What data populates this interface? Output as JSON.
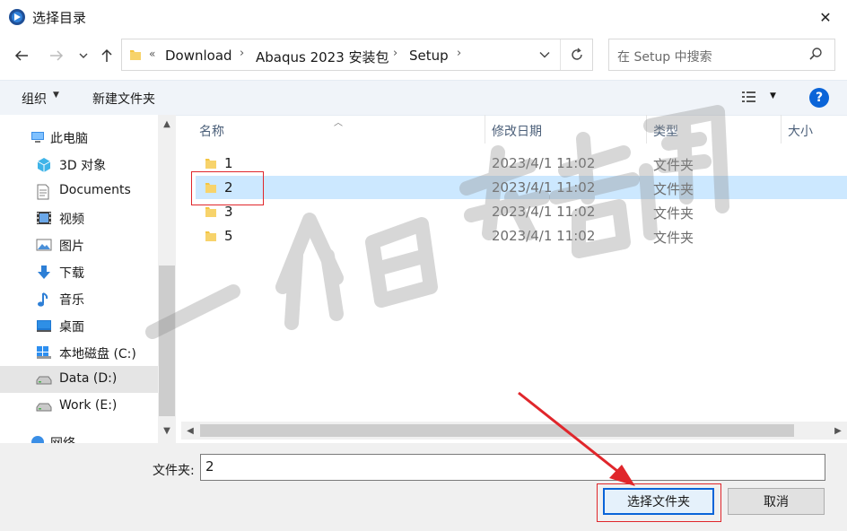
{
  "window": {
    "title": "选择目录",
    "close_glyph": "✕"
  },
  "address": {
    "overflow": "«",
    "breadcrumbs": [
      "Download",
      "Abaqus 2023 安装包",
      "Setup"
    ],
    "separator": "›"
  },
  "search": {
    "placeholder": "在 Setup 中搜索"
  },
  "toolbar": {
    "organize": "组织",
    "new_folder": "新建文件夹",
    "help": "?"
  },
  "sidebar": {
    "items": [
      {
        "label": "此电脑",
        "icon": "pc-icon"
      },
      {
        "label": "3D 对象",
        "icon": "3d-objects-icon"
      },
      {
        "label": "Documents",
        "icon": "documents-icon"
      },
      {
        "label": "视频",
        "icon": "video-icon"
      },
      {
        "label": "图片",
        "icon": "pictures-icon"
      },
      {
        "label": "下载",
        "icon": "download-icon"
      },
      {
        "label": "音乐",
        "icon": "music-icon"
      },
      {
        "label": "桌面",
        "icon": "desktop-icon"
      },
      {
        "label": "本地磁盘 (C:)",
        "icon": "drive-c-icon"
      },
      {
        "label": "Data (D:)",
        "icon": "drive-d-icon",
        "selected": true
      },
      {
        "label": "Work (E:)",
        "icon": "drive-e-icon"
      },
      {
        "label": "网络",
        "icon": "network-icon"
      }
    ]
  },
  "columns": {
    "name": "名称",
    "date": "修改日期",
    "type": "类型",
    "size": "大小"
  },
  "files": [
    {
      "name": "1",
      "date": "2023/4/1 11:02",
      "type": "文件夹"
    },
    {
      "name": "2",
      "date": "2023/4/1 11:02",
      "type": "文件夹",
      "selected": true
    },
    {
      "name": "3",
      "date": "2023/4/1 11:02",
      "type": "文件夹"
    },
    {
      "name": "5",
      "date": "2023/4/1 11:02",
      "type": "文件夹"
    }
  ],
  "bottom": {
    "folder_label": "文件夹:",
    "folder_value": "2",
    "select_button": "选择文件夹",
    "cancel_button": "取消"
  },
  "colors": {
    "accent": "#0a64d8",
    "selection": "#cce8ff",
    "annotation": "#e0262b",
    "folder": "#f4c542"
  }
}
